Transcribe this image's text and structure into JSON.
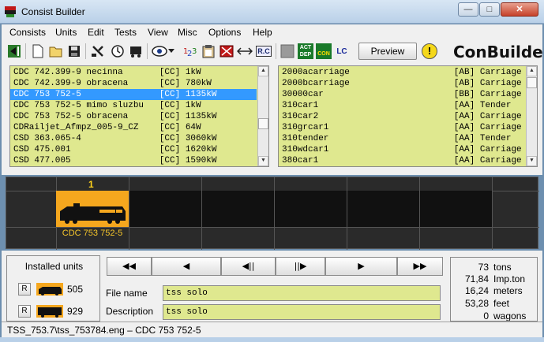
{
  "window": {
    "title": "Consist Builder",
    "min": "—",
    "max": "□",
    "close": "✕"
  },
  "menu": [
    "Consists",
    "Units",
    "Edit",
    "Tests",
    "View",
    "Misc",
    "Options",
    "Help"
  ],
  "toolbar": {
    "icons": [
      "import-icon",
      "new-icon",
      "open-icon",
      "save-icon",
      "tool-icon",
      "clock-icon",
      "wagon-icon",
      "view-icon",
      "dropdown-icon",
      "number-icon",
      "clipboard-icon",
      "stop-icon",
      "swap-icon",
      "rc-icon",
      "gray-square-icon",
      "act-dep-icon",
      "con-icon",
      "lc-icon"
    ],
    "act_label": "ACT DEP",
    "rc_label": "R.C",
    "lc_label": "LC",
    "con_label": "CON",
    "preview_label": "Preview",
    "warning_icon": "!",
    "brand": "ConBuilder"
  },
  "left_list": {
    "rows": [
      "CDC 742.399-9 necinna       [CC] 1kW",
      "CDC 742.399-9 obracena      [CC] 780kW",
      "CDC 753 752-5               [CC] 1135kW",
      "CDC 753 752-5 mimo sluzbu   [CC] 1kW",
      "CDC 753 752-5 obracena      [CC] 1135kW",
      "CDRailjet_Afmpz_005-9_CZ    [CC] 64W",
      "CSD 363.065-4               [CC] 3060kW",
      "CSD 475.001                 [CC] 1620kW",
      "CSD 477.005                 [CC] 1590kW"
    ],
    "selected_index": 2
  },
  "right_list": {
    "rows": [
      "2000acarriage                    [AB] Carriage",
      "2000bcarriage                    [AB] Carriage",
      "30000car                         [BB] Carriage",
      "310car1                          [AA] Tender",
      "310car2                          [AA] Carriage",
      "310grcar1                        [AA] Carriage",
      "310tender                        [AA] Tender",
      "310wdcar1                        [AA] Carriage",
      "380car1                          [AA] Carriage"
    ]
  },
  "consist": {
    "slot_number": "1",
    "slot_label": "CDC 753 752-5"
  },
  "installed": {
    "title": "Installed units",
    "r_label": "R",
    "loco_count": "505",
    "wagon_count": "929"
  },
  "nav": [
    "◀◀",
    "◀",
    "◀||",
    "||▶",
    "▶",
    "▶▶"
  ],
  "fields": {
    "file_label": "File name",
    "file_value": "tss solo",
    "desc_label": "Description",
    "desc_value": "tss solo"
  },
  "stats": [
    {
      "value": "73",
      "unit": "tons"
    },
    {
      "value": "71,84",
      "unit": "Imp.ton"
    },
    {
      "value": "16,24",
      "unit": "meters"
    },
    {
      "value": "53,28",
      "unit": "feet"
    },
    {
      "value": "0",
      "unit": "wagons"
    }
  ],
  "status": "TSS_753.7\\tss_753784.eng – CDC 753 752-5",
  "colors": {
    "list_bg": "#dfe88f",
    "selection": "#3399ff",
    "slot_orange": "#f5a71e",
    "slot_label": "#f7c72a"
  }
}
